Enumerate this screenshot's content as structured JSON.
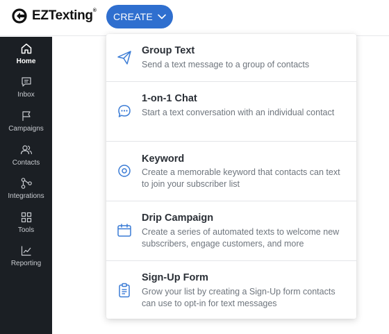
{
  "header": {
    "logo_text": "EZTexting",
    "logo_mark": "®",
    "create_label": "CREATE"
  },
  "sidebar": {
    "items": [
      {
        "label": "Home",
        "icon": "home-icon",
        "active": true
      },
      {
        "label": "Inbox",
        "icon": "inbox-icon"
      },
      {
        "label": "Campaigns",
        "icon": "flag-icon"
      },
      {
        "label": "Contacts",
        "icon": "contacts-icon"
      },
      {
        "label": "Integrations",
        "icon": "integrations-icon"
      },
      {
        "label": "Tools",
        "icon": "tools-grid-icon"
      },
      {
        "label": "Reporting",
        "icon": "chart-icon"
      }
    ]
  },
  "create_menu": {
    "items": [
      {
        "title": "Group Text",
        "description": "Send a text message to a group of contacts",
        "icon": "paper-plane-icon"
      },
      {
        "title": "1-on-1 Chat",
        "description": "Start a text conversation with an individual contact",
        "icon": "chat-bubble-icon"
      },
      {
        "title": "Keyword",
        "description": "Create a memorable keyword that contacts can text to join your subscriber list",
        "icon": "target-icon"
      },
      {
        "title": "Drip Campaign",
        "description": "Create a series of automated texts to welcome new subscribers, engage customers, and more",
        "icon": "calendar-icon"
      },
      {
        "title": "Sign-Up Form",
        "description": "Grow your list by creating a Sign-Up form contacts can use to opt-in for text messages",
        "icon": "clipboard-icon"
      }
    ]
  },
  "colors": {
    "accent": "#2f6fcf",
    "sidebar_bg": "#1b1f24",
    "icon_blue": "#3a7bd5"
  }
}
